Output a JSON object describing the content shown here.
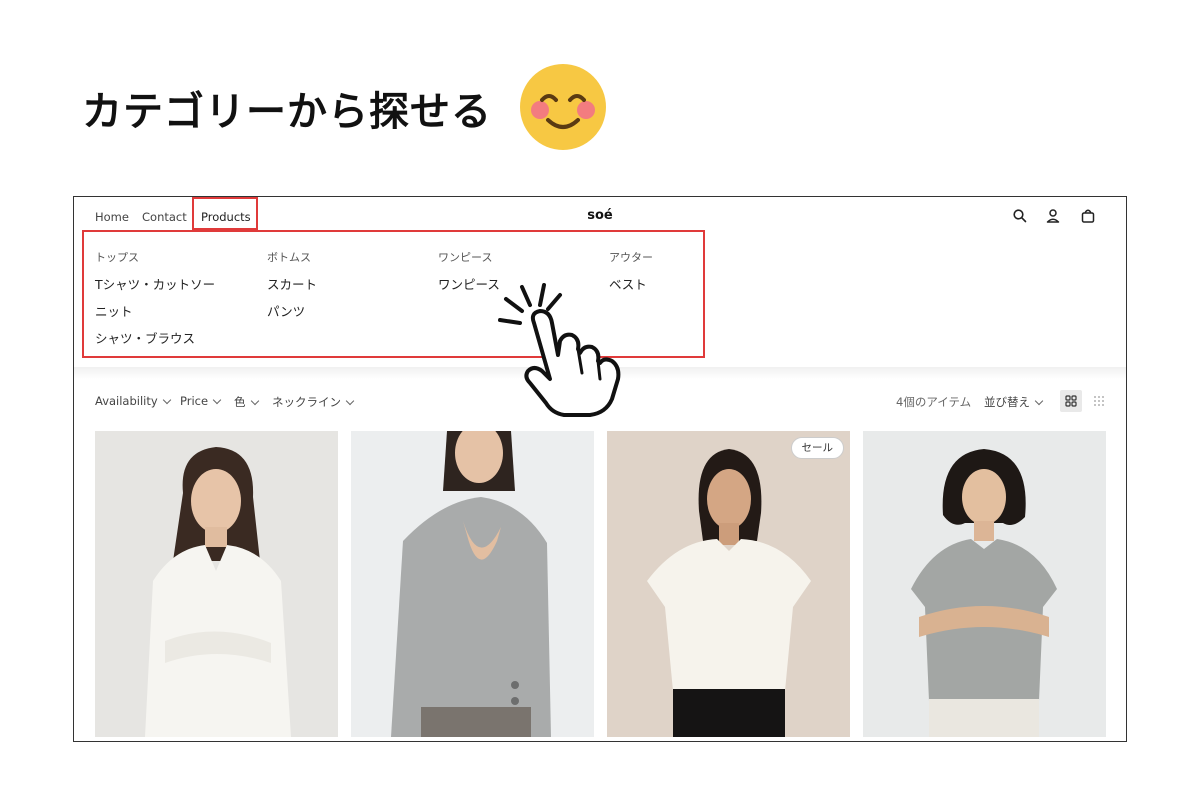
{
  "headline": {
    "text": "カテゴリーから探せる",
    "emoji": "smiling-face-emoji"
  },
  "store": {
    "nav": {
      "home": "Home",
      "contact": "Contact",
      "products": "Products"
    },
    "brand": "soé",
    "icons": [
      "search-icon",
      "account-icon",
      "cart-icon"
    ]
  },
  "mega_menu": {
    "columns": [
      {
        "heading": "トップス",
        "items": [
          "Tシャツ・カットソー",
          "ニット",
          "シャツ・ブラウス"
        ]
      },
      {
        "heading": "ボトムス",
        "items": [
          "スカート",
          "パンツ"
        ]
      },
      {
        "heading": "ワンピース",
        "items": [
          "ワンピース"
        ]
      },
      {
        "heading": "アウター",
        "items": [
          "ベスト"
        ]
      }
    ]
  },
  "filters": {
    "availability": "Availability",
    "price": "Price",
    "color": "色",
    "neckline": "ネックライン",
    "item_count": "4個のアイテム",
    "sort": "並び替え"
  },
  "products": [
    {
      "badge": "",
      "garment": "white-shirt"
    },
    {
      "badge": "",
      "garment": "gray-cardigan"
    },
    {
      "badge": "セール",
      "garment": "white-tshirt"
    },
    {
      "badge": "",
      "garment": "gray-knit"
    }
  ],
  "colors": {
    "highlight": "#e03a3a",
    "frame": "#333333",
    "emoji": "#f7c843"
  }
}
